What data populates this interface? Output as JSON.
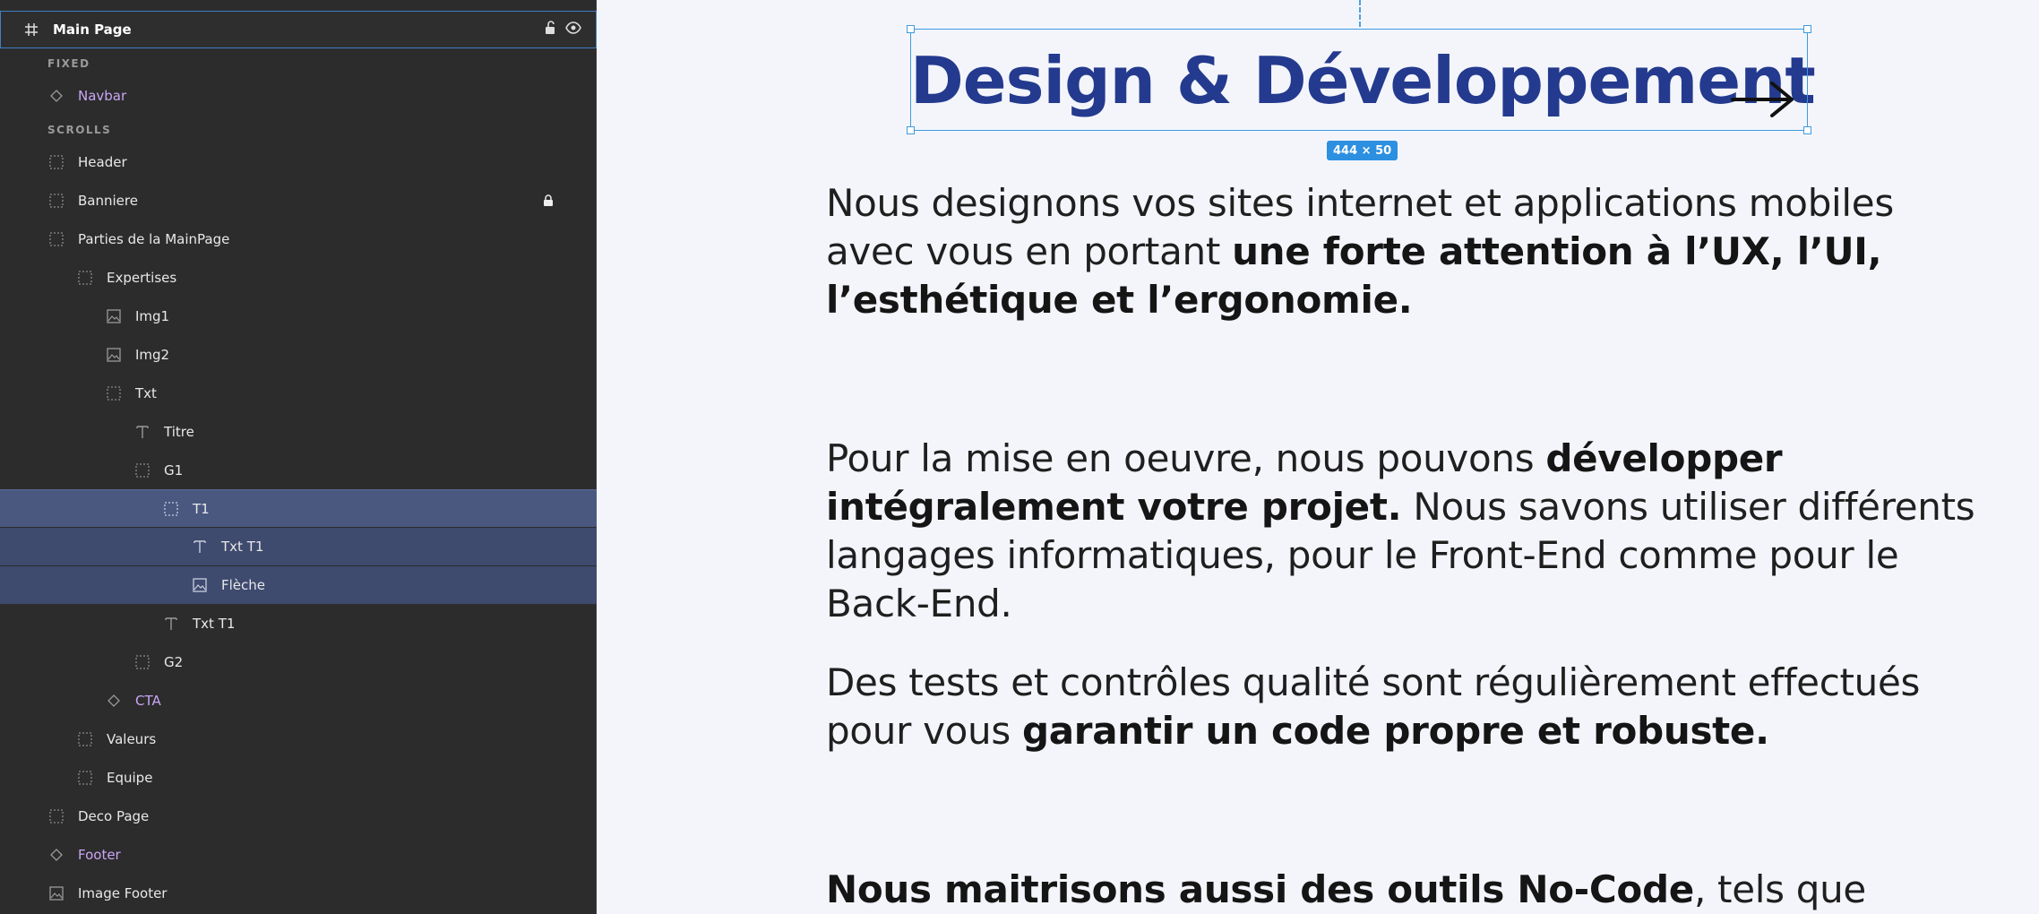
{
  "layers": {
    "root": "Main Page",
    "sections": {
      "fixed": "FIXED",
      "scrolls": "SCROLLS"
    },
    "items": [
      {
        "label": "Navbar"
      },
      {
        "label": "Header"
      },
      {
        "label": "Banniere"
      },
      {
        "label": "Parties de la MainPage"
      },
      {
        "label": "Expertises"
      },
      {
        "label": "Img1"
      },
      {
        "label": "Img2"
      },
      {
        "label": "Txt"
      },
      {
        "label": "Titre"
      },
      {
        "label": "G1"
      },
      {
        "label": "T1"
      },
      {
        "label": "Txt T1"
      },
      {
        "label": "Flèche"
      },
      {
        "label": "Txt T1"
      },
      {
        "label": "G2"
      },
      {
        "label": "CTA"
      },
      {
        "label": "Valeurs"
      },
      {
        "label": "Equipe"
      },
      {
        "label": "Deco Page"
      },
      {
        "label": "Footer"
      },
      {
        "label": "Image Footer"
      }
    ]
  },
  "canvas": {
    "title": "Design & Développement",
    "size_badge": "444 × 50",
    "p1": {
      "a": "Nous designons vos sites internet et applications mobiles avec vous en portant ",
      "b": "une forte attention à l’UX, l’UI, l’esthétique et l’ergonomie."
    },
    "p2": {
      "a": "Pour la mise en oeuvre, nous pouvons ",
      "b": "développer intégralement votre projet.",
      "c": " Nous savons utiliser différents langages informatiques, pour le Front-End comme pour le Back-End."
    },
    "p3": {
      "a": "Des tests et contrôles qualité sont  régulièrement effectués pour vous ",
      "b": "garantir un code propre et robuste."
    },
    "p4": {
      "b": "Nous maitrisons aussi des outils No-Code",
      "a": ", tels que"
    }
  },
  "colors": {
    "panel_bg": "#2c2c2c",
    "selection": "#3e4a6e",
    "accent_blue": "#3d9be0",
    "title_blue": "#233a8e",
    "component_purple": "#c9a6f5"
  }
}
